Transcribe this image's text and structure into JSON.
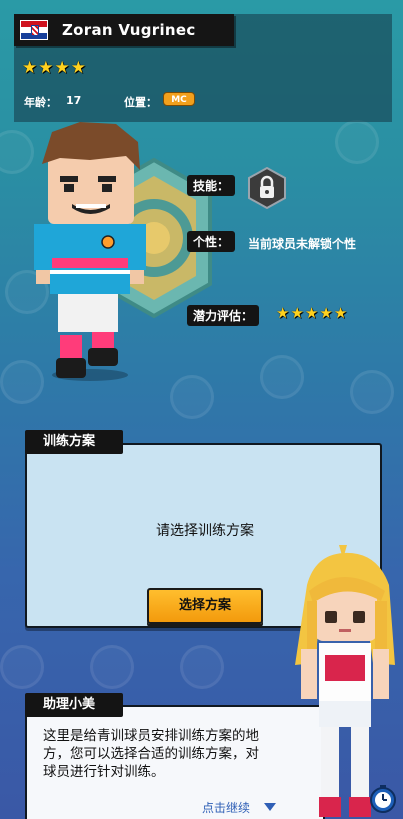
{
  "player": {
    "flag": "croatia-flag",
    "name": "Zoran Vugrinec",
    "stars": 4,
    "age_label": "年龄：",
    "age": "17",
    "position_label": "位置：",
    "position": "MC"
  },
  "attributes": {
    "skill_label": "技能：",
    "skill_icon": "lock-icon",
    "trait_label": "个性：",
    "trait_value": "当前球员未解锁个性",
    "potential_label": "潜力评估：",
    "potential_stars": 5
  },
  "training": {
    "title": "训练方案",
    "prompt": "请选择训练方案",
    "button_label": "选择方案"
  },
  "assistant": {
    "title": "助理小美",
    "message": "这里是给青训球员安排训练方案的地方，您可以选择合适的训练方案，对球员进行针对训练。",
    "continue_label": "点击继续"
  },
  "colors": {
    "star": "#ffd21f",
    "button": "#f39a0c",
    "card": "#c9e3f2",
    "continue": "#2f5fb6"
  }
}
